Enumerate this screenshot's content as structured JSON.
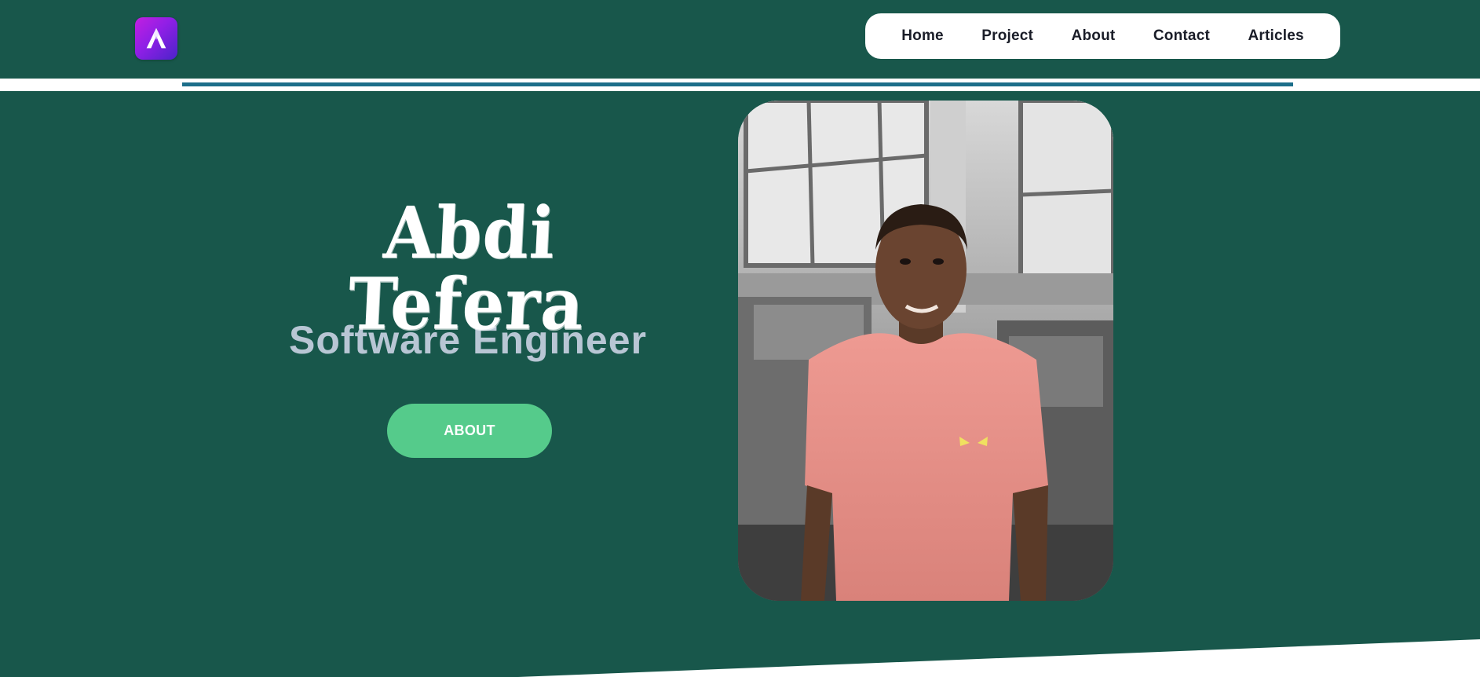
{
  "header": {
    "logo_icon": "aurora-a-logo-icon",
    "logo_colors": [
      "#c21fe0",
      "#4a23c9"
    ]
  },
  "nav": {
    "items": [
      {
        "label": "Home"
      },
      {
        "label": "Project"
      },
      {
        "label": "About"
      },
      {
        "label": "Contact"
      },
      {
        "label": "Articles"
      }
    ]
  },
  "hero": {
    "name": "Abdi Tefera",
    "role": "Software Engineer",
    "cta_label": "ABOUT",
    "cta_color": "#55cb8b"
  },
  "photo": {
    "subject": "person-portrait-photo"
  },
  "theme": {
    "background": "#18574b",
    "divider_line": "#1c6e8a",
    "role_text": "#b8c6d4"
  }
}
